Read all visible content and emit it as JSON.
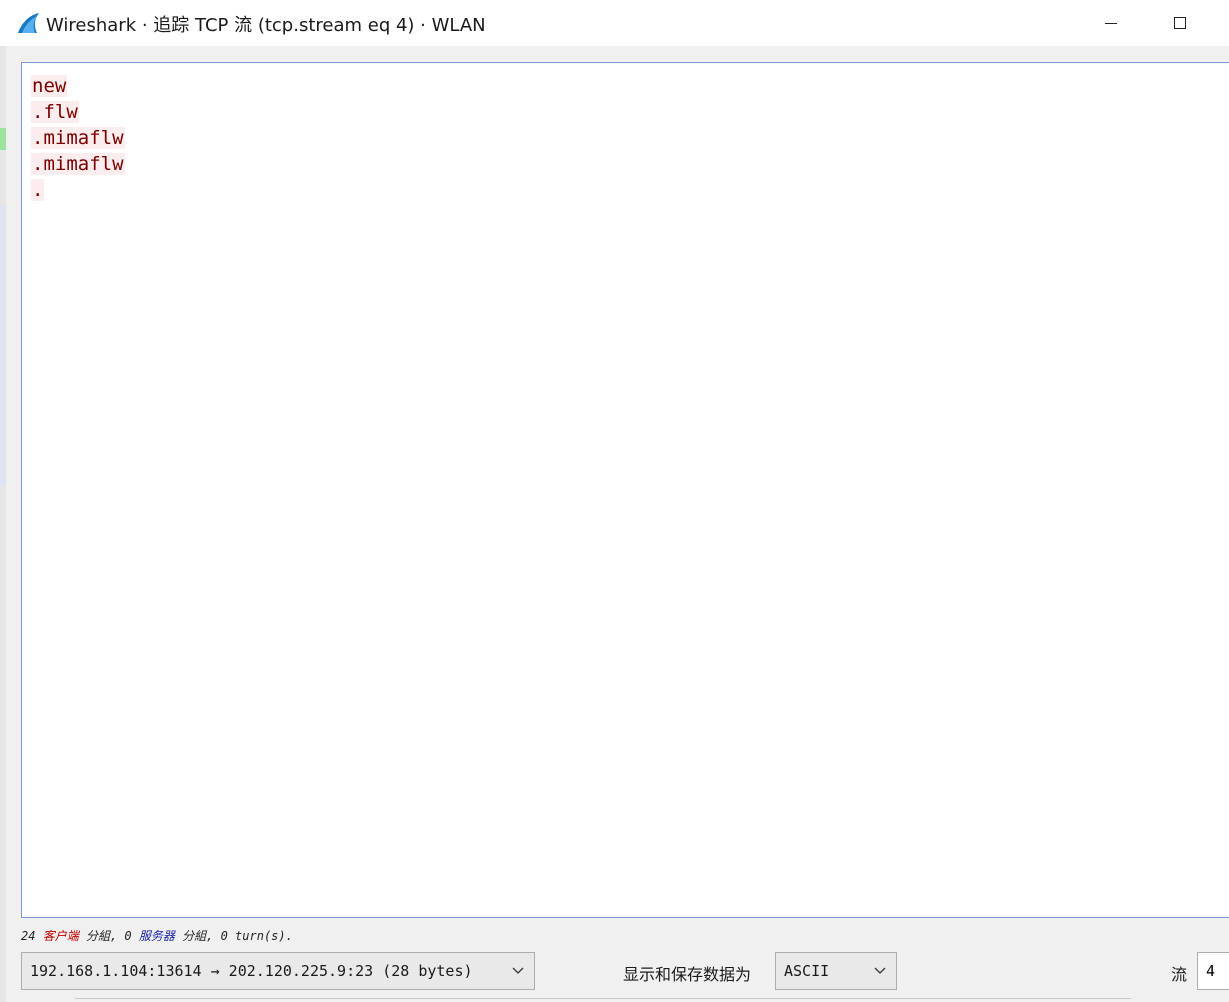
{
  "window": {
    "title": "Wireshark · 追踪 TCP 流 (tcp.stream eq 4) · WLAN",
    "app_icon": "wireshark-fin-icon",
    "minimize_icon": "minimize-icon",
    "maximize_icon": "maximize-icon"
  },
  "stream": {
    "lines": [
      "new",
      ".flw",
      ".mimaflw",
      ".mimaflw",
      "."
    ],
    "client_text_color": "#7a0000",
    "client_bg_color": "#fbeded"
  },
  "status": {
    "client_count": "24",
    "client_label": "客户端",
    "packets_word_1": "分組,",
    "server_count": "0",
    "server_label": "服务器",
    "packets_word_2": "分組,",
    "turns": "0 turn(s)."
  },
  "controls": {
    "conversation_value": "192.168.1.104:13614 → 202.120.225.9:23 (28 bytes)",
    "format_label": "显示和保存数据为",
    "format_value": "ASCII",
    "stream_label": "流",
    "stream_value": "4"
  },
  "colors": {
    "accent_border": "#7a9cd3",
    "client_status": "#c00000",
    "server_status": "#1a24a8"
  }
}
